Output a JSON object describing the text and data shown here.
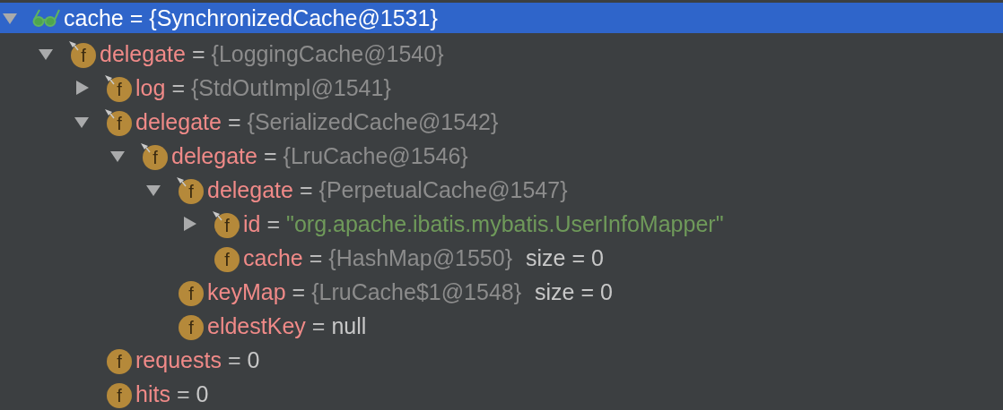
{
  "tree": [
    {
      "kind": "watch",
      "name": "cache",
      "separator": "=",
      "value": {
        "text": "{SynchronizedCache@1531}"
      },
      "expanded": true,
      "selected": true,
      "children": [
        {
          "kind": "field",
          "badge": "f",
          "name": "delegate",
          "separator": "=",
          "value": {
            "kind": "object",
            "text": "{LoggingCache@1540}"
          },
          "expanded": true,
          "selected": false,
          "final": true,
          "children": [
            {
              "kind": "field",
              "badge": "f",
              "name": "log",
              "separator": "=",
              "value": {
                "kind": "object",
                "text": "{StdOutImpl@1541}"
              },
              "expanded": false,
              "selected": false,
              "final": true
            },
            {
              "kind": "field",
              "badge": "f",
              "name": "delegate",
              "separator": "=",
              "value": {
                "kind": "object",
                "text": "{SerializedCache@1542}"
              },
              "expanded": true,
              "selected": false,
              "final": true,
              "children": [
                {
                  "kind": "field",
                  "badge": "f",
                  "name": "delegate",
                  "separator": "=",
                  "value": {
                    "kind": "object",
                    "text": "{LruCache@1546}"
                  },
                  "expanded": true,
                  "selected": false,
                  "final": true,
                  "children": [
                    {
                      "kind": "field",
                      "badge": "f",
                      "name": "delegate",
                      "separator": "=",
                      "value": {
                        "kind": "object",
                        "text": "{PerpetualCache@1547}"
                      },
                      "expanded": true,
                      "selected": false,
                      "final": true,
                      "children": [
                        {
                          "kind": "field",
                          "badge": "f",
                          "name": "id",
                          "separator": "=",
                          "value": {
                            "kind": "string",
                            "text": "\"org.apache.ibatis.mybatis.UserInfoMapper\""
                          },
                          "expanded": false,
                          "selected": false,
                          "final": true
                        },
                        {
                          "kind": "field",
                          "badge": "f",
                          "name": "cache",
                          "separator": "=",
                          "value": {
                            "kind": "object",
                            "text": "{HashMap@1550}"
                          },
                          "extra": "size = 0",
                          "selected": false,
                          "final": false
                        }
                      ]
                    },
                    {
                      "kind": "field",
                      "badge": "f",
                      "name": "keyMap",
                      "separator": "=",
                      "value": {
                        "kind": "object",
                        "text": "{LruCache$1@1548}"
                      },
                      "extra": "size = 0",
                      "selected": false,
                      "final": false
                    },
                    {
                      "kind": "field",
                      "badge": "f",
                      "name": "eldestKey",
                      "separator": "=",
                      "value": {
                        "kind": "plain",
                        "text": "null"
                      },
                      "selected": false,
                      "final": false
                    }
                  ]
                }
              ]
            },
            {
              "kind": "field",
              "badge": "f",
              "name": "requests",
              "separator": "=",
              "value": {
                "kind": "plain",
                "text": "0"
              },
              "selected": false,
              "final": false
            },
            {
              "kind": "field",
              "badge": "f",
              "name": "hits",
              "separator": "=",
              "value": {
                "kind": "plain",
                "text": "0"
              },
              "selected": false,
              "final": false
            }
          ]
        }
      ]
    }
  ]
}
